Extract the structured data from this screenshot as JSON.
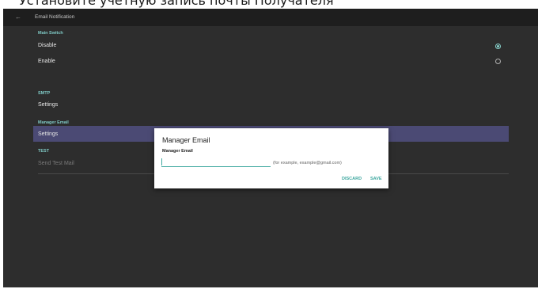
{
  "caption": "Установите учетную запись почты Получателя",
  "appbar": {
    "back_icon": "←",
    "title": "Email Notification"
  },
  "sections": {
    "main_switch": {
      "header": "Main Switch",
      "options": [
        {
          "label": "Disable",
          "checked": true
        },
        {
          "label": "Enable",
          "checked": false
        }
      ]
    },
    "smtp": {
      "header": "SMTP",
      "item": "Settings"
    },
    "manager_email": {
      "header": "Manager Email",
      "item": "Settings"
    },
    "test": {
      "header": "TEST",
      "item": "Send Test Mail"
    }
  },
  "dialog": {
    "title": "Manager Email",
    "field_label": "Manager Email",
    "input_value": "",
    "hint": "(for example, example@gmail.com)",
    "discard_label": "DISCARD",
    "save_label": "SAVE"
  },
  "colors": {
    "accent": "#8ad6cf",
    "highlight": "#4b4a74",
    "background": "#2d2d2d"
  }
}
